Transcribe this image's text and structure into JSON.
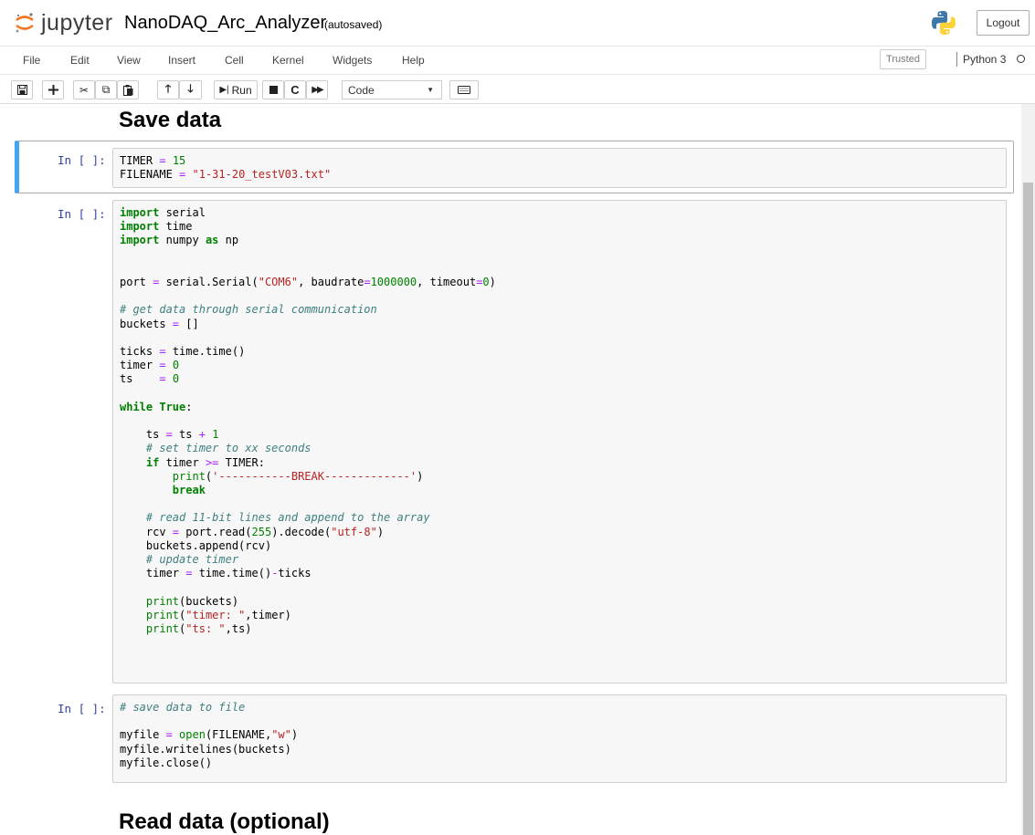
{
  "header": {
    "logo_text": "jupyter",
    "notebook_name": "NanoDAQ_Arc_Analyzer",
    "autosave_status": "(autosaved)",
    "logout_label": "Logout"
  },
  "menubar": {
    "items": [
      "File",
      "Edit",
      "View",
      "Insert",
      "Cell",
      "Kernel",
      "Widgets",
      "Help"
    ],
    "trusted_label": "Trusted",
    "kernel_name": "Python 3"
  },
  "toolbar": {
    "run_label": "Run",
    "cell_type": "Code",
    "icons": [
      "save-icon",
      "add-cell-icon",
      "cut-icon",
      "copy-icon",
      "paste-icon",
      "move-up-icon",
      "move-down-icon",
      "run-icon",
      "stop-icon",
      "restart-icon",
      "fast-forward-icon",
      "keyboard-icon"
    ]
  },
  "notebook": {
    "heading_save": "Save data",
    "heading_read": "Read data (optional)",
    "cells": [
      {
        "prompt": "In [ ]:",
        "lines": [
          "TIMER = 15",
          "FILENAME = \"1-31-20_testV03.txt\""
        ]
      },
      {
        "prompt": "In [ ]:",
        "lines": [
          "import serial",
          "import time",
          "import numpy as np",
          "",
          "",
          "port = serial.Serial(\"COM6\", baudrate=1000000, timeout=0)",
          "",
          "# get data through serial communication",
          "buckets = []",
          "",
          "ticks = time.time()",
          "timer = 0",
          "ts    = 0",
          "",
          "while True:",
          "",
          "    ts = ts + 1",
          "    # set timer to xx seconds",
          "    if timer >= TIMER:",
          "        print('-----------BREAK-------------')",
          "        break",
          "",
          "    # read 11-bit lines and append to the array",
          "    rcv = port.read(255).decode(\"utf-8\")",
          "    buckets.append(rcv)",
          "    # update timer",
          "    timer = time.time()-ticks",
          "",
          "    print(buckets)",
          "    print(\"timer: \",timer)",
          "    print(\"ts: \",ts)"
        ]
      },
      {
        "prompt": "In [ ]:",
        "lines": [
          "# save data to file",
          "",
          "myfile = open(FILENAME,\"w\")",
          "myfile.writelines(buckets)",
          "myfile.close()"
        ]
      }
    ]
  },
  "colors": {
    "selected_cell_bar": "#42a5f5",
    "prompt": "#303f9f",
    "keyword": "#008000",
    "string": "#ba2121",
    "comment": "#408080"
  }
}
